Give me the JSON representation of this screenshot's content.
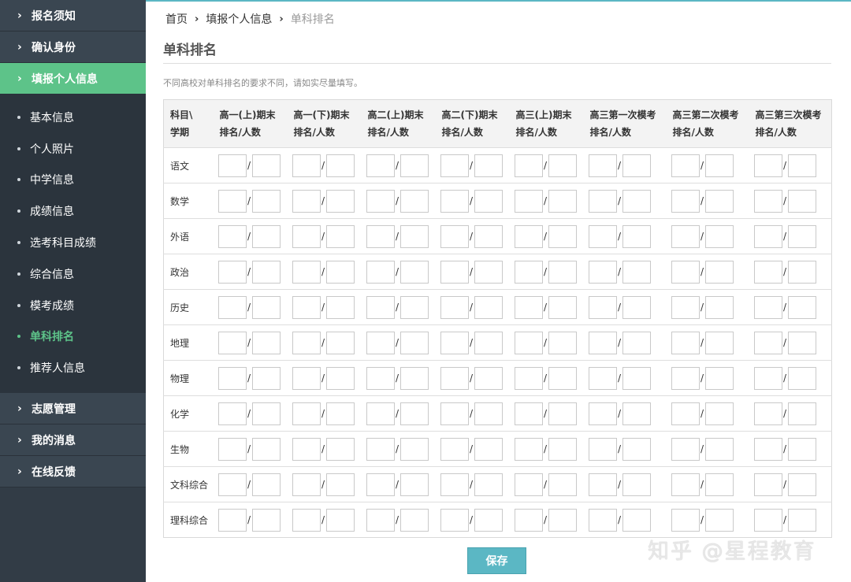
{
  "sidebar": {
    "top_items": [
      {
        "label": "报名须知"
      },
      {
        "label": "确认身份"
      },
      {
        "label": "填报个人信息",
        "active": true
      }
    ],
    "sub_items": [
      {
        "label": "基本信息"
      },
      {
        "label": "个人照片"
      },
      {
        "label": "中学信息"
      },
      {
        "label": "成绩信息"
      },
      {
        "label": "选考科目成绩"
      },
      {
        "label": "综合信息"
      },
      {
        "label": "模考成绩"
      },
      {
        "label": "单科排名",
        "current": true
      },
      {
        "label": "推荐人信息"
      }
    ],
    "bottom_items": [
      {
        "label": "志愿管理"
      },
      {
        "label": "我的消息"
      },
      {
        "label": "在线反馈"
      }
    ],
    "chevron_icon": "chevron-right-icon",
    "active_color": "#5dc389"
  },
  "breadcrumb": {
    "home": "首页",
    "section": "填报个人信息",
    "current": "单科排名"
  },
  "page": {
    "title": "单科排名",
    "hint": "不同高校对单科排名的要求不同，请如实尽量填写。"
  },
  "table": {
    "corner_header": [
      "科目\\",
      "学期"
    ],
    "columns": [
      {
        "line1": "高一(上)期末",
        "line2": "排名/人数"
      },
      {
        "line1": "高一(下)期末",
        "line2": "排名/人数"
      },
      {
        "line1": "高二(上)期末",
        "line2": "排名/人数"
      },
      {
        "line1": "高二(下)期末",
        "line2": "排名/人数"
      },
      {
        "line1": "高三(上)期末",
        "line2": "排名/人数"
      },
      {
        "line1": "高三第一次模考",
        "line2": "排名/人数"
      },
      {
        "line1": "高三第二次模考",
        "line2": "排名/人数"
      },
      {
        "line1": "高三第三次模考",
        "line2": "排名/人数"
      }
    ],
    "subjects": [
      "语文",
      "数学",
      "外语",
      "政治",
      "历史",
      "地理",
      "物理",
      "化学",
      "生物",
      "文科综合",
      "理科综合"
    ],
    "separator": "/"
  },
  "actions": {
    "save_label": "保存"
  },
  "watermark": "知乎 @星程教育",
  "colors": {
    "sidebar_bg": "#323c46",
    "accent_green": "#5dc389",
    "accent_teal": "#5bb7c4"
  }
}
